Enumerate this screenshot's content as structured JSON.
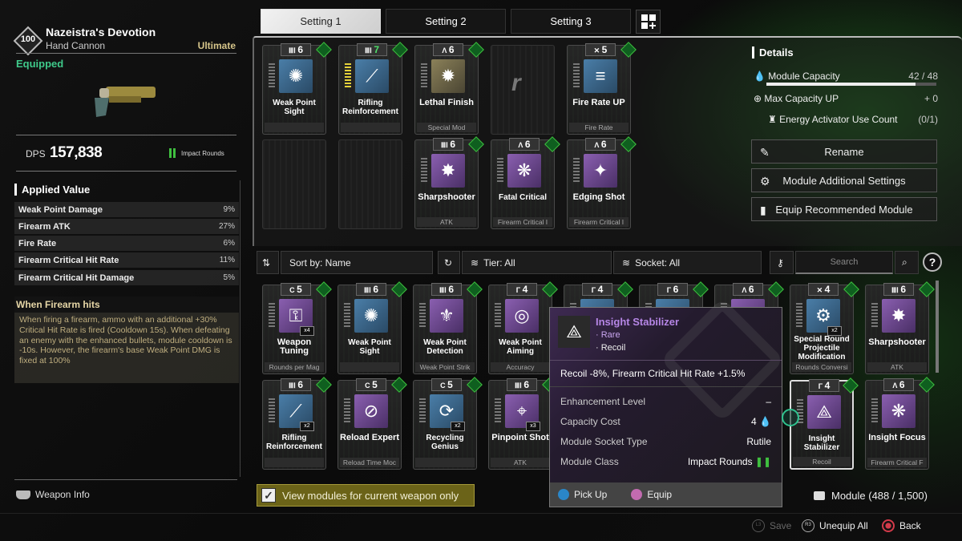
{
  "weapon": {
    "level": "100",
    "name": "Nazeistra's Devotion",
    "type": "Hand Cannon",
    "rarity": "Ultimate",
    "status": "Equipped",
    "dps_label": "DPS",
    "dps_value": "157,838",
    "ammo_type": "Impact Rounds"
  },
  "applied_value": {
    "title": "Applied Value",
    "rows": [
      {
        "label": "Weak Point Damage",
        "value": "9%"
      },
      {
        "label": "Firearm ATK",
        "value": "27%"
      },
      {
        "label": "Fire Rate",
        "value": "6%"
      },
      {
        "label": "Firearm Critical Hit Rate",
        "value": "11%"
      },
      {
        "label": "Firearm Critical Hit Damage",
        "value": "5%"
      }
    ]
  },
  "trait": {
    "title": "When Firearm hits",
    "description": "When firing a firearm, ammo with an additional +30% Critical Hit Rate is fired (Cooldown 15s). When defeating an enemy with the enhanced bullets, module cooldown is -10s. However, the firearm's base Weak Point DMG is fixed at 100%"
  },
  "weapon_info_label": "Weapon Info",
  "tabs": [
    {
      "label": "Setting 1",
      "active": true
    },
    {
      "label": "Setting 2",
      "active": false
    },
    {
      "label": "Setting 3",
      "active": false
    }
  ],
  "equipped_modules": [
    {
      "cost": "6",
      "socket": "Xantic",
      "name": "Weak Point Sight",
      "sub": "",
      "icon": "blue",
      "glyph": "✺"
    },
    {
      "cost": "7",
      "socket": "Xantic",
      "name": "Rifling Reinforcement",
      "sub": "",
      "icon": "blue",
      "glyph": "⟋"
    },
    {
      "cost": "6",
      "socket": "Almandine",
      "name": "Lethal Finish",
      "sub": "Special Mod",
      "icon": "gold",
      "glyph": "✹"
    },
    {
      "empty": true,
      "glyph": "r"
    },
    {
      "cost": "5",
      "socket": "Malachite",
      "name": "Fire Rate UP",
      "sub": "Fire Rate",
      "icon": "blue",
      "glyph": "≡"
    },
    {
      "empty": true
    },
    {
      "empty": true
    },
    {
      "cost": "6",
      "socket": "Xantic",
      "name": "Sharpshooter",
      "sub": "ATK",
      "icon": "purple",
      "glyph": "✸"
    },
    {
      "cost": "6",
      "socket": "Almandine",
      "name": "Fatal Critical",
      "sub": "Firearm Critical I",
      "icon": "purple",
      "glyph": "❋"
    },
    {
      "cost": "6",
      "socket": "Almandine",
      "name": "Edging Shot",
      "sub": "Firearm Critical I",
      "icon": "purple",
      "glyph": "✦"
    }
  ],
  "details": {
    "title": "Details",
    "module_capacity_label": "Module Capacity",
    "module_capacity_value": "42 / 48",
    "module_capacity_fraction": 0.875,
    "max_capacity_label": "Max Capacity UP",
    "max_capacity_value": "+ 0",
    "energy_label": "Energy Activator Use Count",
    "energy_value": "(0/1)",
    "buttons": [
      "Rename",
      "Module Additional Settings",
      "Equip Recommended Module"
    ]
  },
  "filters": {
    "sort": "Sort by: Name",
    "tier": "Tier: All",
    "socket": "Socket: All",
    "search_placeholder": "Search",
    "help": "?"
  },
  "inventory": [
    {
      "cost": "5",
      "socket": "Cerulean",
      "name": "Weapon Tuning",
      "sub": "Rounds per Mag",
      "icon": "purple",
      "glyph": "⚿",
      "stack": "x4"
    },
    {
      "cost": "6",
      "socket": "Xantic",
      "name": "Weak Point Sight",
      "sub": "",
      "icon": "blue",
      "glyph": "✺"
    },
    {
      "cost": "6",
      "socket": "Xantic",
      "name": "Weak Point Detection",
      "sub": "Weak Point Strik",
      "icon": "purple",
      "glyph": "⚜"
    },
    {
      "cost": "4",
      "socket": "Rutile",
      "name": "Weak Point Aiming",
      "sub": "Accuracy",
      "icon": "purple",
      "glyph": "◎"
    },
    {
      "cost": "4",
      "socket": "Rutile",
      "name": "",
      "sub": "",
      "icon": "blue",
      "glyph": ""
    },
    {
      "cost": "6",
      "socket": "Rutile",
      "name": "",
      "sub": "",
      "icon": "blue",
      "glyph": ""
    },
    {
      "cost": "6",
      "socket": "Almandine",
      "name": "",
      "sub": "",
      "icon": "purple",
      "glyph": ""
    },
    {
      "cost": "4",
      "socket": "Malachite",
      "name": "Special Round Projectile Modification",
      "sub": "Rounds Conversi",
      "icon": "blue",
      "glyph": "⚙",
      "stack": "x2"
    },
    {
      "cost": "6",
      "socket": "Xantic",
      "name": "Sharpshooter",
      "sub": "ATK",
      "icon": "purple",
      "glyph": "✸"
    },
    {
      "cost": "6",
      "socket": "Xantic",
      "name": "Rifling Reinforcement",
      "sub": "",
      "icon": "blue",
      "glyph": "⟋",
      "stack": "x2"
    },
    {
      "cost": "5",
      "socket": "Cerulean",
      "name": "Reload Expert",
      "sub": "Reload Time Moc",
      "icon": "purple",
      "glyph": "⊘"
    },
    {
      "cost": "5",
      "socket": "Cerulean",
      "name": "Recycling Genius",
      "sub": "",
      "icon": "blue",
      "glyph": "⟳",
      "stack": "x2"
    },
    {
      "cost": "6",
      "socket": "Xantic",
      "name": "Pinpoint Shot",
      "sub": "ATK",
      "icon": "purple",
      "glyph": "⌖",
      "stack": "x3"
    },
    {
      "cost": "4",
      "socket": "Rutile",
      "name": "Insight Stabilizer",
      "sub": "Recoil",
      "icon": "purple",
      "glyph": "⟁",
      "selected": true
    },
    {
      "cost": "6",
      "socket": "Almandine",
      "name": "Insight Focus",
      "sub": "Firearm Critical F",
      "icon": "purple",
      "glyph": "❋"
    }
  ],
  "tooltip": {
    "name": "Insight Stabilizer",
    "rarity": "Rare",
    "socket_category": "Recoil",
    "effect": "Recoil -8%, Firearm Critical Hit Rate +1.5%",
    "rows": [
      {
        "label": "Enhancement Level",
        "value": "–"
      },
      {
        "label": "Capacity Cost",
        "value": "4 💧"
      },
      {
        "label": "Module Socket Type",
        "value": "Rutile"
      },
      {
        "label": "Module Class",
        "value": "Impact Rounds"
      }
    ],
    "actions": [
      {
        "key": "cross",
        "label": "Pick Up",
        "color": "#2a86c8"
      },
      {
        "key": "square",
        "label": "Equip",
        "color": "#c26bb0"
      }
    ]
  },
  "view_current_only": {
    "label": "View modules for current weapon only",
    "checked": true
  },
  "module_count": "Module (488 / 1,500)",
  "footer": [
    {
      "key": "L3",
      "label": "Save",
      "disabled": true
    },
    {
      "key": "R3",
      "label": "Unequip All",
      "disabled": false
    },
    {
      "key": "circle",
      "label": "Back",
      "disabled": false
    }
  ],
  "colors": {
    "accent_green": "#3fc98a",
    "ultimate_gold": "#d6c58a",
    "rare_purple": "#b686e6"
  }
}
